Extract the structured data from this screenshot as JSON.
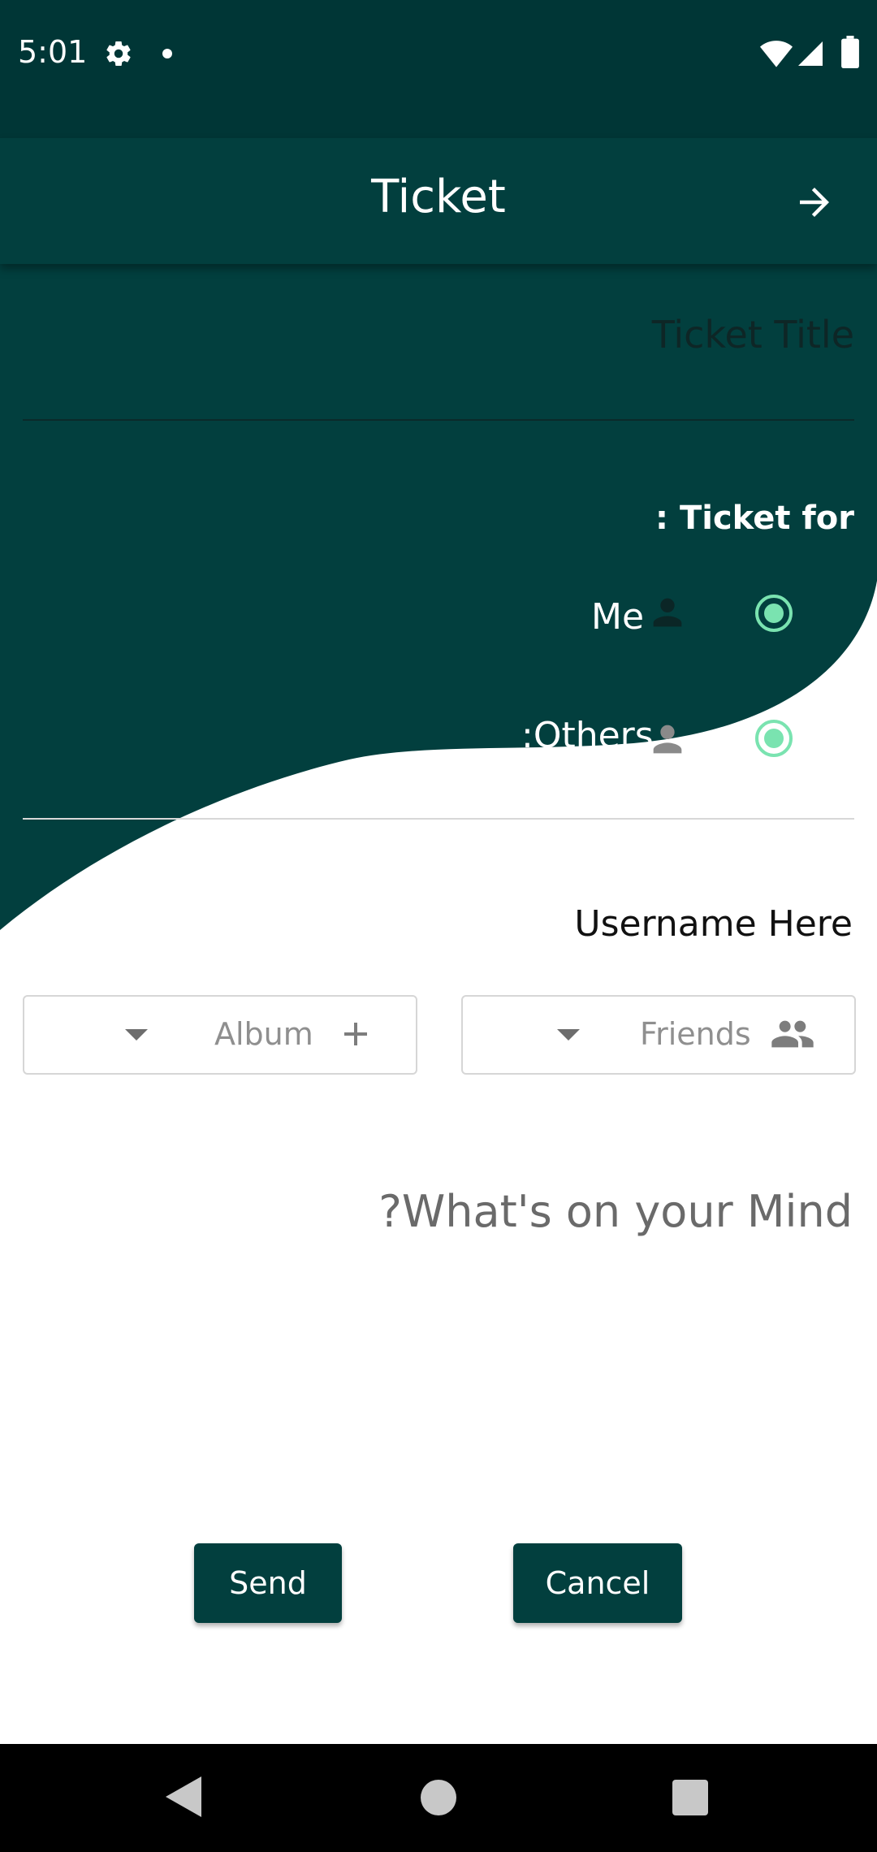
{
  "status_bar": {
    "time": "5:01"
  },
  "toolbar": {
    "title": "Ticket",
    "forward_icon": "arrow-right-icon"
  },
  "form": {
    "ticket_title_label": "Ticket Title",
    "ticket_for_label": ": Ticket for",
    "radio_me_label": "Me",
    "radio_others_label": ":Others",
    "username_label": "Username Here",
    "album_dropdown_label": "Album",
    "friends_dropdown_label": "Friends",
    "mind_placeholder": "?What's on your Mind"
  },
  "buttons": {
    "send_label": "Send",
    "cancel_label": "Cancel"
  },
  "colors": {
    "status_bar": "#003636",
    "toolbar": "#023f3e",
    "accent_radio": "#7ae3b0",
    "button": "#023f3e"
  }
}
